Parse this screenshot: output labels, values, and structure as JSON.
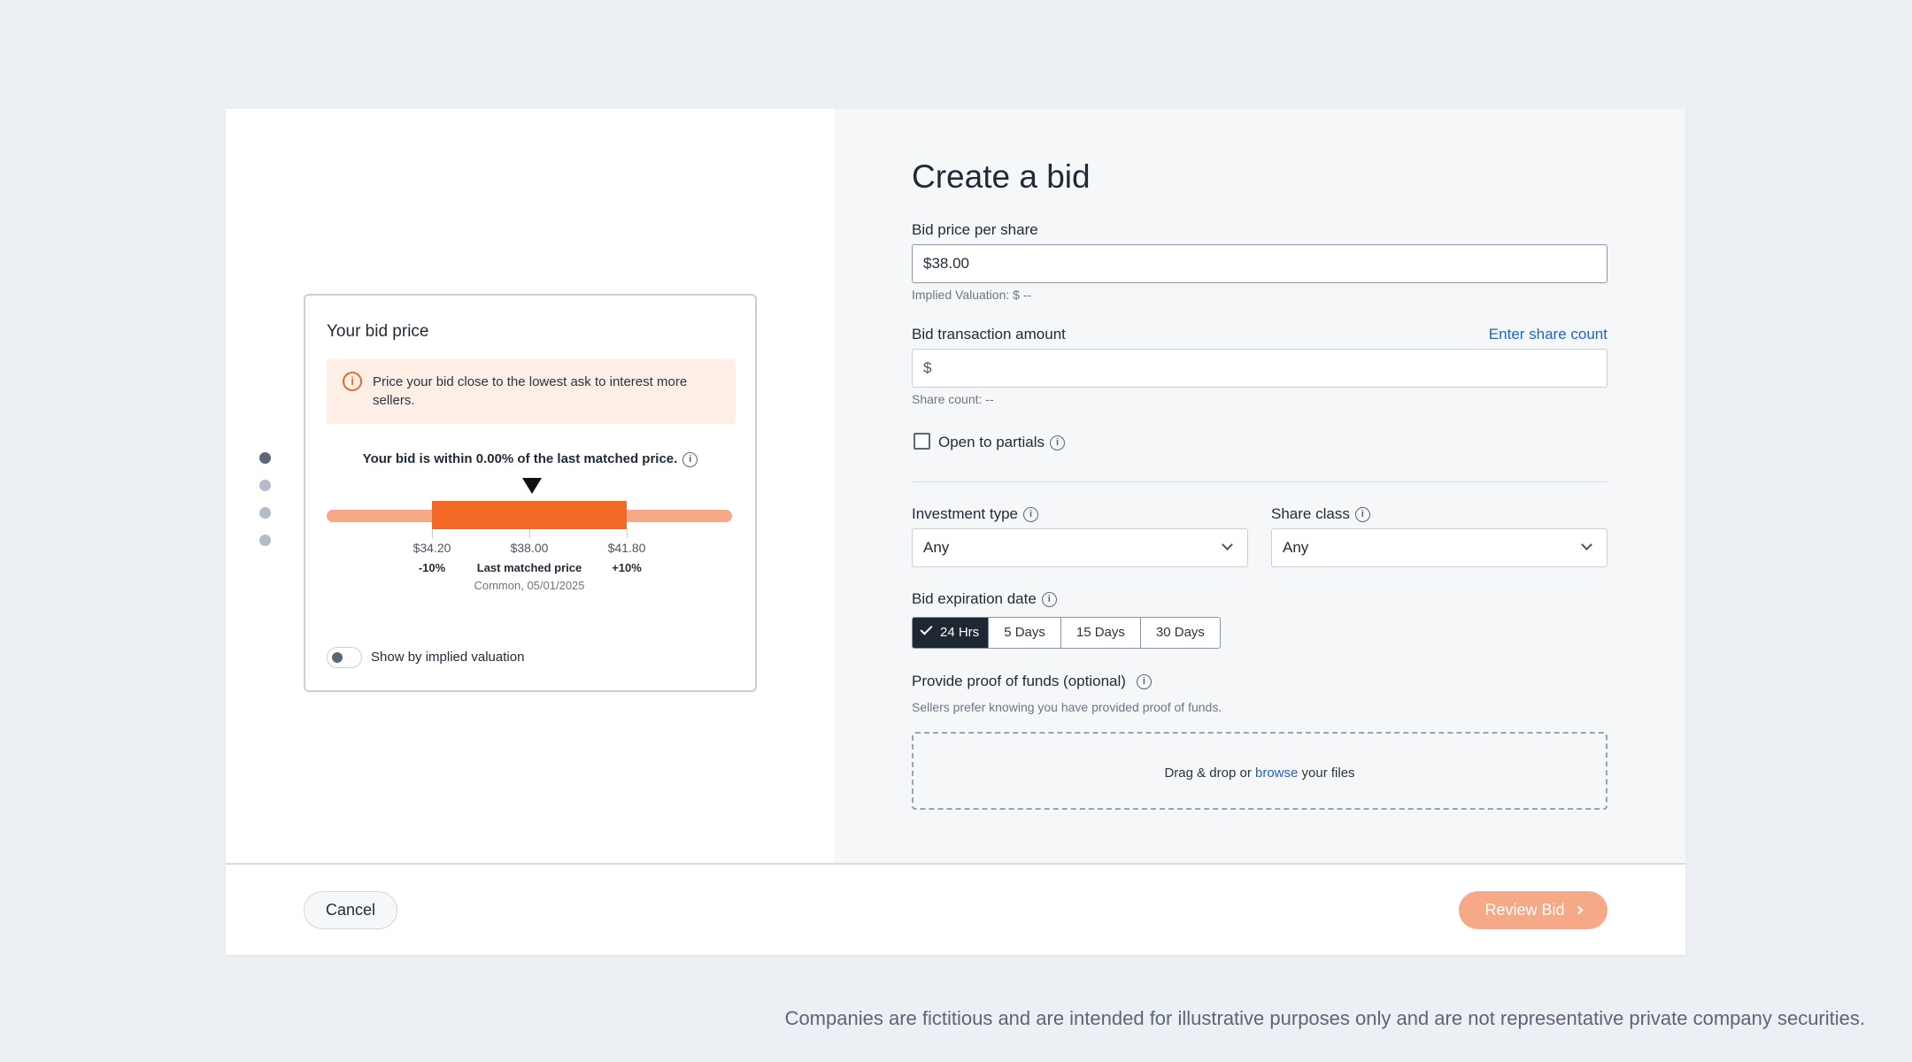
{
  "card": {
    "title": "Your bid price",
    "alert_text": "Price your bid close to the lowest ask to interest more sellers.",
    "within_text": "Your bid is within 0.00% of the last matched price.",
    "low_price": "$34.20",
    "low_pct": "-10%",
    "mid_price": "$38.00",
    "mid_label": "Last matched price",
    "mid_sub": "Common, 05/01/2025",
    "high_price": "$41.80",
    "high_pct": "+10%",
    "toggle_label": "Show by implied valuation",
    "toggle_on": false
  },
  "stepper": {
    "total": 4,
    "active": 1
  },
  "form": {
    "title": "Create a bid",
    "bid_price_label": "Bid price per share",
    "bid_price_value": "$38.00",
    "implied_valuation": "Implied Valuation: $ --",
    "transaction_label": "Bid transaction amount",
    "enter_share_count": "Enter share count",
    "transaction_value": "$",
    "share_count": "Share count: --",
    "open_partials": "Open to partials",
    "investment_type_label": "Investment type",
    "investment_type_value": "Any",
    "share_class_label": "Share class",
    "share_class_value": "Any",
    "expiration_label": "Bid expiration date",
    "expiration_options": [
      "24 Hrs",
      "5 Days",
      "15 Days",
      "30 Days"
    ],
    "expiration_selected": "24 Hrs",
    "proof_label": "Provide proof of funds (optional)",
    "proof_hint": "Sellers prefer knowing you have provided proof of funds.",
    "drop_prefix": "Drag & drop or",
    "drop_link": "browse",
    "drop_suffix": "your files"
  },
  "footer": {
    "cancel": "Cancel",
    "review": "Review Bid"
  },
  "disclaimer": "Companies are fictitious and are intended for illustrative purposes only and are not representative private company securities.",
  "colors": {
    "accent": "#f26a25",
    "accent_light": "#f6a987",
    "link": "#2563c4",
    "background": "#eceff3"
  }
}
